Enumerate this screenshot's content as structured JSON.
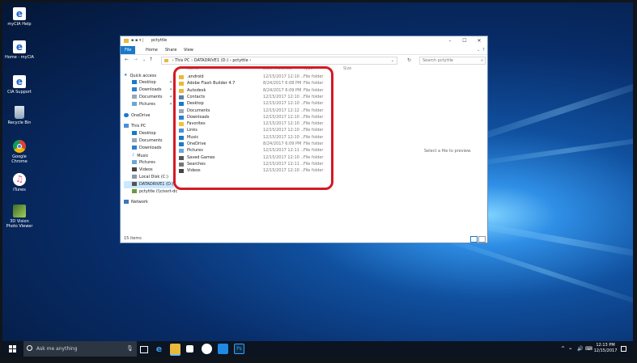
{
  "desktop": {
    "icons": [
      {
        "label": "myCIA Help",
        "icon": "ie-shortcut-icon",
        "color": "#1e64c8"
      },
      {
        "label": "Home - myCIA",
        "icon": "ie-shortcut-icon",
        "color": "#1e64c8"
      },
      {
        "label": "CIA Support",
        "icon": "ie-shortcut-icon",
        "color": "#1e64c8"
      },
      {
        "label": "Recycle Bin",
        "icon": "recycle-bin-icon",
        "color": "#9ab"
      },
      {
        "label": "Google Chrome",
        "icon": "chrome-icon",
        "color": "#e3a21a"
      },
      {
        "label": "iTunes",
        "icon": "itunes-icon",
        "color": "#e84a8a"
      },
      {
        "label": "3D Vision Photo Viewer",
        "icon": "3d-vision-icon",
        "color": "#6a9a3a"
      }
    ]
  },
  "explorer": {
    "title": "pctyttle",
    "ribbon_tabs": [
      "File",
      "Home",
      "Share",
      "View"
    ],
    "path": [
      "This PC",
      "DATADRIVE1 (D:)",
      "pctyttle"
    ],
    "search_placeholder": "Search pctyttle",
    "nav": {
      "quick_access_label": "Quick access",
      "quick_access": [
        "Desktop",
        "Downloads",
        "Documents",
        "Pictures"
      ],
      "onedrive_label": "OneDrive",
      "this_pc_label": "This PC",
      "this_pc": [
        "Desktop",
        "Documents",
        "Downloads",
        "Music",
        "Pictures",
        "Videos",
        "Local Disk (C:)",
        "DATADRIVE1 (D:)",
        "pctyttle (\\\\cissrt-dc"
      ],
      "network_label": "Network"
    },
    "columns": [
      "Name",
      "Date modified",
      "Type",
      "Size"
    ],
    "files": [
      {
        "name": ".android",
        "date": "12/15/2017 12:10 ...",
        "type": "File folder",
        "icon": "folder-icon"
      },
      {
        "name": "Adobe Flash Builder 4.7",
        "date": "8/24/2017 6:08 PM",
        "type": "File folder",
        "icon": "folder-icon"
      },
      {
        "name": "Autodesk",
        "date": "8/24/2017 6:09 PM",
        "type": "File folder",
        "icon": "folder-icon"
      },
      {
        "name": "Contacts",
        "date": "12/15/2017 12:10 ...",
        "type": "File folder",
        "icon": "contacts-icon"
      },
      {
        "name": "Desktop",
        "date": "12/15/2017 12:10 ...",
        "type": "File folder",
        "icon": "desktop-icon"
      },
      {
        "name": "Documents",
        "date": "12/15/2017 12:12 ...",
        "type": "File folder",
        "icon": "documents-icon"
      },
      {
        "name": "Downloads",
        "date": "12/15/2017 12:10 ...",
        "type": "File folder",
        "icon": "downloads-icon"
      },
      {
        "name": "Favorites",
        "date": "12/15/2017 12:10 ...",
        "type": "File folder",
        "icon": "favorites-icon"
      },
      {
        "name": "Links",
        "date": "12/15/2017 12:10 ...",
        "type": "File folder",
        "icon": "links-icon"
      },
      {
        "name": "Music",
        "date": "12/15/2017 12:10 ...",
        "type": "File folder",
        "icon": "music-icon"
      },
      {
        "name": "OneDrive",
        "date": "8/24/2017 6:09 PM",
        "type": "File folder",
        "icon": "onedrive-icon"
      },
      {
        "name": "Pictures",
        "date": "12/15/2017 12:11 ...",
        "type": "File folder",
        "icon": "pictures-icon"
      },
      {
        "name": "Saved Games",
        "date": "12/15/2017 12:10 ...",
        "type": "File folder",
        "icon": "saved-games-icon"
      },
      {
        "name": "Searches",
        "date": "12/15/2017 12:11 ...",
        "type": "File folder",
        "icon": "searches-icon"
      },
      {
        "name": "Videos",
        "date": "12/15/2017 12:10 ...",
        "type": "File folder",
        "icon": "videos-icon"
      }
    ],
    "preview_text": "Select a file to preview.",
    "status_text": "15 items"
  },
  "taskbar": {
    "search_placeholder": "Ask me anything",
    "clock_time": "12:13 PM",
    "clock_date": "12/15/2017"
  },
  "colors": {
    "accent": "#1979ca",
    "highlight": "#d31a24",
    "folder": "#e8b93a"
  }
}
